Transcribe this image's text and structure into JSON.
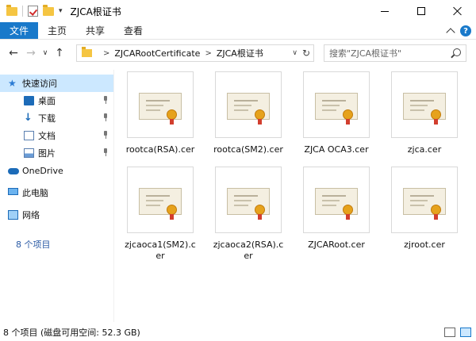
{
  "window": {
    "title": "ZJCA根证书",
    "qa_dropdown": "▾"
  },
  "ribbon": {
    "tabs": [
      {
        "label": "文件",
        "active": true
      },
      {
        "label": "主页"
      },
      {
        "label": "共享"
      },
      {
        "label": "查看"
      }
    ],
    "accent": "#1979ca",
    "help": "?"
  },
  "nav": {
    "back": "←",
    "forward": "→",
    "recent": "∨",
    "up": "↑",
    "crumbs": [
      "ZJCARootCertificate",
      "ZJCA根证书"
    ],
    "crumb_sep": ">",
    "addr_dropdown": "∨",
    "refresh": "↻",
    "search_placeholder": "搜索\"ZJCA根证书\""
  },
  "sidebar": {
    "items": [
      {
        "label": "快速访问",
        "icon": "star-icon",
        "selected": true
      },
      {
        "label": "桌面",
        "icon": "desktop-icon",
        "pinned": true
      },
      {
        "label": "下载",
        "icon": "download-icon",
        "pinned": true
      },
      {
        "label": "文档",
        "icon": "document-icon",
        "pinned": true
      },
      {
        "label": "图片",
        "icon": "picture-icon",
        "pinned": true
      },
      {
        "label": "OneDrive",
        "icon": "cloud-icon"
      },
      {
        "label": "此电脑",
        "icon": "computer-icon"
      },
      {
        "label": "网络",
        "icon": "network-icon"
      }
    ],
    "item_count": "8 个项目"
  },
  "files": [
    {
      "name": "rootca(RSA).cer",
      "icon": "certificate-icon"
    },
    {
      "name": "rootca(SM2).cer",
      "icon": "certificate-icon"
    },
    {
      "name": "ZJCA OCA3.cer",
      "icon": "certificate-icon"
    },
    {
      "name": "zjca.cer",
      "icon": "certificate-icon"
    },
    {
      "name": "zjcaoca1(SM2).cer",
      "icon": "certificate-icon"
    },
    {
      "name": "zjcaoca2(RSA).cer",
      "icon": "certificate-icon"
    },
    {
      "name": "ZJCARoot.cer",
      "icon": "certificate-icon"
    },
    {
      "name": "zjroot.cer",
      "icon": "certificate-icon"
    }
  ],
  "status": {
    "text": "8 个项目 (磁盘可用空间: 52.3 GB)"
  }
}
